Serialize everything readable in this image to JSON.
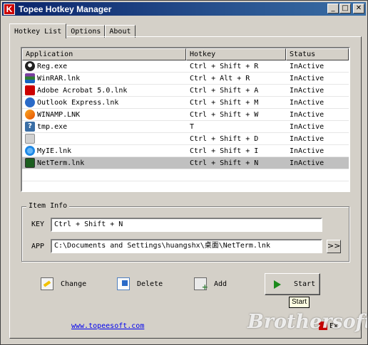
{
  "window": {
    "title": "Topee Hotkey Manager",
    "icon_letter": "K",
    "controls": {
      "minimize": "_",
      "maximize": "□",
      "close": "✕"
    }
  },
  "tabs": [
    {
      "label": "Hotkey List",
      "active": true
    },
    {
      "label": "Options",
      "active": false
    },
    {
      "label": "About",
      "active": false
    }
  ],
  "hotkey_list": {
    "columns": [
      "Application",
      "Hotkey",
      "Status"
    ],
    "rows": [
      {
        "icon": "reg-icon",
        "application": "Reg.exe",
        "hotkey": "Ctrl + Shift + R",
        "status": "InActive"
      },
      {
        "icon": "winrar-icon",
        "application": "WinRAR.lnk",
        "hotkey": "Ctrl + Alt + R",
        "status": "InActive"
      },
      {
        "icon": "acrobat-icon",
        "application": "Adobe Acrobat 5.0.lnk",
        "hotkey": "Ctrl + Shift + A",
        "status": "InActive"
      },
      {
        "icon": "outlook-icon",
        "application": "Outlook Express.lnk",
        "hotkey": "Ctrl + Shift + M",
        "status": "InActive"
      },
      {
        "icon": "winamp-icon",
        "application": "WINAMP.LNK",
        "hotkey": "Ctrl + Shift + W",
        "status": "InActive"
      },
      {
        "icon": "unknown-file-icon",
        "application": "tmp.exe",
        "hotkey": "T",
        "status": "InActive"
      },
      {
        "icon": "blank-icon",
        "application": "",
        "hotkey": "Ctrl + Shift + D",
        "status": "InActive"
      },
      {
        "icon": "myie-icon",
        "application": "MyIE.lnk",
        "hotkey": "Ctrl + Shift + I",
        "status": "InActive"
      },
      {
        "icon": "netterm-icon",
        "application": "NetTerm.lnk",
        "hotkey": "Ctrl + Shift + N",
        "status": "InActive",
        "selected": true
      }
    ]
  },
  "item_info": {
    "legend": "Item Info",
    "key_label": "KEY",
    "key_value": "Ctrl + Shift + N",
    "app_label": "APP",
    "app_value": "C:\\Documents and Settings\\huangshx\\桌面\\NetTerm.lnk",
    "browse_label": ">>"
  },
  "actions": {
    "change": "Change",
    "delete": "Delete",
    "add": "Add",
    "start": "Start"
  },
  "tooltip": "Start",
  "footer": {
    "link": "www.topeesoft.com",
    "exit_label": "Ex"
  },
  "watermark": "Brothersoft",
  "colors": {
    "titlebar_start": "#0a246a",
    "titlebar_end": "#3a6ea5",
    "face": "#d4d0c8",
    "selected_row": "#c0c0c0",
    "link": "#0000ee"
  }
}
